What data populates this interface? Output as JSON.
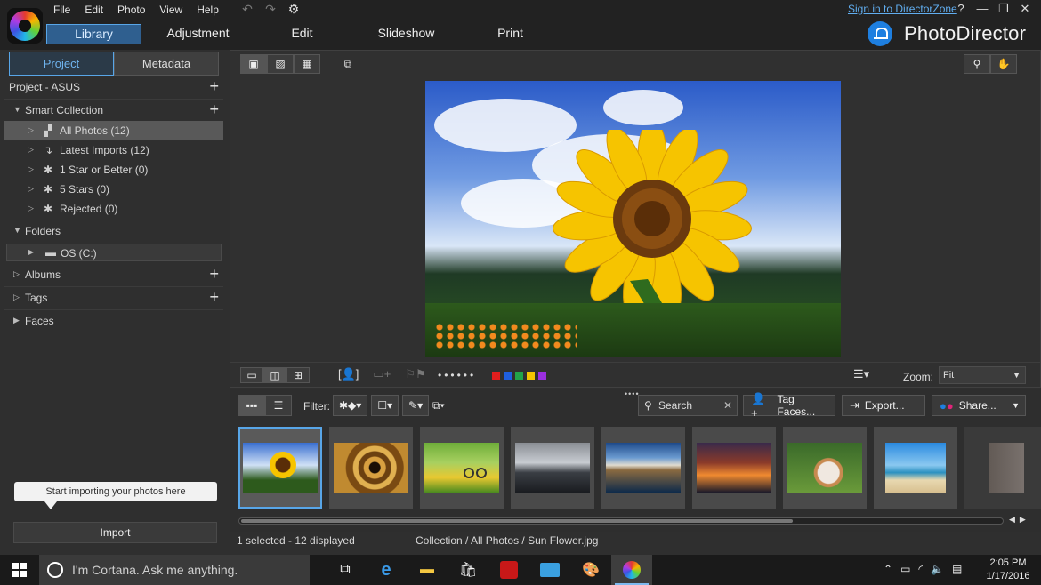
{
  "menu": [
    "File",
    "Edit",
    "Photo",
    "View",
    "Help"
  ],
  "modes": [
    {
      "label": "Library",
      "active": true
    },
    {
      "label": "Adjustment",
      "active": false
    },
    {
      "label": "Edit",
      "active": false
    },
    {
      "label": "Slideshow",
      "active": false
    },
    {
      "label": "Print",
      "active": false
    }
  ],
  "header": {
    "signin": "Sign in to DirectorZone",
    "brand": "PhotoDirector",
    "help": "?",
    "minimize": "—",
    "restore": "❐",
    "close": "✕"
  },
  "left": {
    "tabs": {
      "project": "Project",
      "metadata": "Metadata"
    },
    "project_title": "Project - ASUS",
    "smart_collection": "Smart Collection",
    "collections": [
      {
        "label": "All Photos (12)",
        "icon": "all-photos-icon",
        "selected": true
      },
      {
        "label": "Latest Imports (12)",
        "icon": "latest-imports-icon",
        "selected": false
      },
      {
        "label": "1 Star or Better (0)",
        "icon": "star-rule-icon",
        "selected": false
      },
      {
        "label": "5 Stars (0)",
        "icon": "star-rule-icon",
        "selected": false
      },
      {
        "label": "Rejected (0)",
        "icon": "reject-rule-icon",
        "selected": false
      }
    ],
    "folders": "Folders",
    "drive": "OS (C:)",
    "albums": "Albums",
    "tags": "Tags",
    "faces": "Faces",
    "import_hint": "Start importing your photos here",
    "import_button": "Import"
  },
  "viewer": {
    "zoom_label": "Zoom:",
    "zoom_value": "Fit",
    "color_labels": [
      "#e01e1e",
      "#1f5fe0",
      "#22a34a",
      "#f5c400",
      "#9b2fe0"
    ]
  },
  "browser": {
    "filter_label": "Filter:",
    "search_placeholder": "Search",
    "tag_faces": "Tag Faces...",
    "export": "Export...",
    "share": "Share...",
    "thumbnails": [
      {
        "name": "sunflower",
        "selected": true
      },
      {
        "name": "spiral-staircase",
        "selected": false
      },
      {
        "name": "bicycle-field",
        "selected": false
      },
      {
        "name": "pier-sunset-grey",
        "selected": false
      },
      {
        "name": "mountain-lake",
        "selected": false
      },
      {
        "name": "sunset-clouds",
        "selected": false
      },
      {
        "name": "cat-grass",
        "selected": false
      },
      {
        "name": "beach-couple",
        "selected": false
      },
      {
        "name": "portrait-partial",
        "selected": false
      }
    ]
  },
  "status": {
    "selection": "1 selected - 12 displayed",
    "path": "Collection / All Photos / Sun Flower.jpg"
  },
  "taskbar": {
    "cortana": "I'm Cortana. Ask me anything.",
    "time": "2:05 PM",
    "date": "1/17/2016"
  }
}
